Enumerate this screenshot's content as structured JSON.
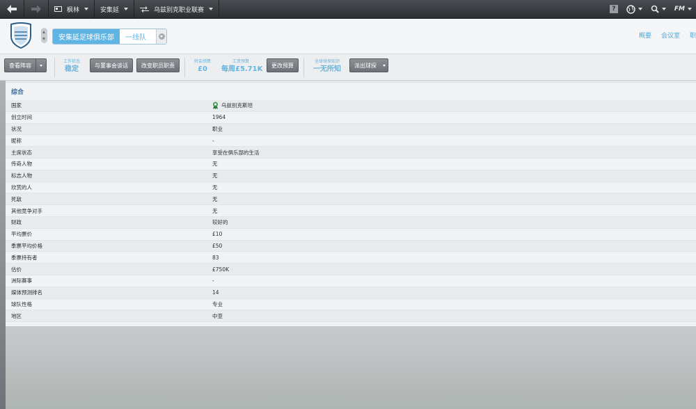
{
  "nav": {
    "crumbs": [
      "枫林",
      "安集延",
      "乌兹别克职业联赛"
    ],
    "help_label": "?",
    "fm_label": "FM"
  },
  "club": {
    "name": "安集延足球俱乐部",
    "team": "一线队",
    "tabs": [
      "概要",
      "会议室",
      "职"
    ]
  },
  "toolbar": {
    "view_squad": "查看阵容",
    "job_status_key": "工作状态",
    "job_status_value": "稳定",
    "talk_board": "与董事会谈话",
    "change_staff": "改变职员职责",
    "transfer_key": "转会预算",
    "transfer_value": "£0",
    "wage_key": "工资预算",
    "wage_value": "每周£5.71K",
    "change_budget": "更改预算",
    "scout_key": "全球球探知识",
    "scout_value": "一无所知",
    "send_scout": "派出球探"
  },
  "panel": {
    "title": "综合",
    "rows": [
      {
        "label": "国家",
        "value": "乌兹别克斯坦",
        "flag": true
      },
      {
        "label": "创立时间",
        "value": "1964"
      },
      {
        "label": "状况",
        "value": "职业"
      },
      {
        "label": "昵称",
        "value": "-"
      },
      {
        "label": "主席状态",
        "value": "享受在俱乐部的生活"
      },
      {
        "label": "传奇人物",
        "value": "无"
      },
      {
        "label": "标志人物",
        "value": "无"
      },
      {
        "label": "欣赏的人",
        "value": "无"
      },
      {
        "label": "死敌",
        "value": "无"
      },
      {
        "label": "其他竞争对手",
        "value": "无"
      },
      {
        "label": "财政",
        "value": "较好的"
      },
      {
        "label": "平均票价",
        "value": "£10"
      },
      {
        "label": "季票平均价格",
        "value": "£50"
      },
      {
        "label": "季票持有者",
        "value": "83"
      },
      {
        "label": "估价",
        "value": "£750K"
      },
      {
        "label": "洲际赛事",
        "value": "-"
      },
      {
        "label": "媒体预测排名",
        "value": "14"
      },
      {
        "label": "球队性格",
        "value": "专业"
      },
      {
        "label": "地区",
        "value": "中亚"
      }
    ]
  },
  "colors": {
    "accent": "#5eb4e2",
    "title": "#3e6d9c",
    "topbar": "#3a3c40"
  }
}
